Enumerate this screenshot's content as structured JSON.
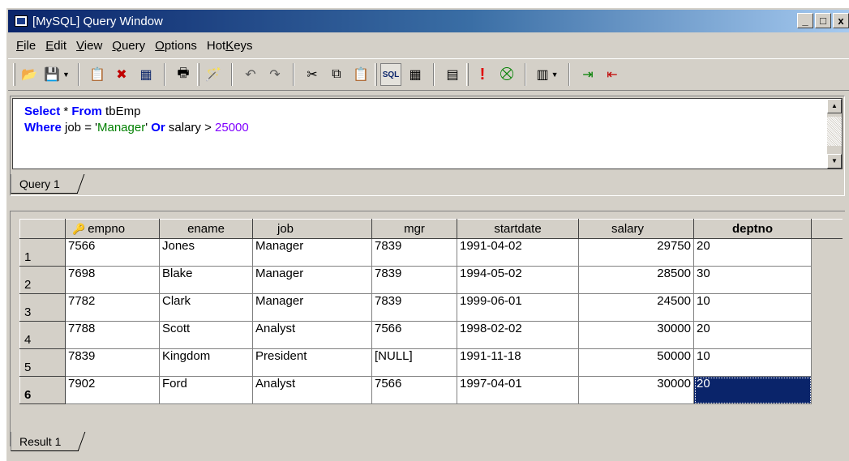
{
  "window": {
    "title": "[MySQL] Query Window",
    "controls": {
      "minimize": "_",
      "maximize": "□",
      "close": "x"
    }
  },
  "menu": [
    {
      "prefix": "",
      "mnemonic": "F",
      "rest": "ile"
    },
    {
      "prefix": "",
      "mnemonic": "E",
      "rest": "dit"
    },
    {
      "prefix": "",
      "mnemonic": "V",
      "rest": "iew"
    },
    {
      "prefix": "",
      "mnemonic": "Q",
      "rest": "uery"
    },
    {
      "prefix": "",
      "mnemonic": "O",
      "rest": "ptions"
    },
    {
      "prefix": "Hot",
      "mnemonic": "K",
      "rest": "eys"
    }
  ],
  "toolbar": {
    "icons": {
      "open": "📂",
      "save": "💾",
      "new_query": "📋",
      "delete": "✖",
      "table": "▦",
      "print": "🖶",
      "wand": "🪄",
      "undo": "↶",
      "redo": "↷",
      "cut": "✂",
      "copy": "⧉",
      "paste": "📋",
      "sql": "SQL",
      "grid": "▦",
      "form": "▤",
      "execute": "!",
      "stop": "⛒",
      "columns": "▥",
      "insert_row": "⇥",
      "delete_row": "⇤"
    }
  },
  "query": {
    "line1": {
      "kw1": "Select",
      "star": " * ",
      "kw2": "From",
      "rest": " tbEmp"
    },
    "line2": {
      "kw1": "Where",
      "field1": " job = '",
      "str": "Manager",
      "quote": "' ",
      "kw2": "Or",
      "field2": " salary > ",
      "num": "25000"
    },
    "tab_label": "Query 1"
  },
  "results": {
    "tab_label": "Result 1",
    "columns": [
      "empno",
      "ename",
      "job",
      "mgr",
      "startdate",
      "salary",
      "deptno"
    ],
    "rows": [
      {
        "num": "1",
        "empno": "7566",
        "ename": "Jones",
        "job": "Manager",
        "mgr": "7839",
        "startdate": "1991-04-02",
        "salary": "29750",
        "deptno": "20"
      },
      {
        "num": "2",
        "empno": "7698",
        "ename": "Blake",
        "job": "Manager",
        "mgr": "7839",
        "startdate": "1994-05-02",
        "salary": "28500",
        "deptno": "30"
      },
      {
        "num": "3",
        "empno": "7782",
        "ename": "Clark",
        "job": "Manager",
        "mgr": "7839",
        "startdate": "1999-06-01",
        "salary": "24500",
        "deptno": "10"
      },
      {
        "num": "4",
        "empno": "7788",
        "ename": "Scott",
        "job": "Analyst",
        "mgr": "7566",
        "startdate": "1998-02-02",
        "salary": "30000",
        "deptno": "20"
      },
      {
        "num": "5",
        "empno": "7839",
        "ename": "Kingdom",
        "job": "President",
        "mgr": "[NULL]",
        "startdate": "1991-11-18",
        "salary": "50000",
        "deptno": "10"
      },
      {
        "num": "6",
        "empno": "7902",
        "ename": "Ford",
        "job": "Analyst",
        "mgr": "7566",
        "startdate": "1997-04-01",
        "salary": "30000",
        "deptno": "20"
      }
    ]
  },
  "colors": {
    "title_start": "#0a246a",
    "title_end": "#a6caf0",
    "keyword": "#0000ff",
    "string": "#008000",
    "number": "#8000ff",
    "selection": "#0a246a"
  }
}
